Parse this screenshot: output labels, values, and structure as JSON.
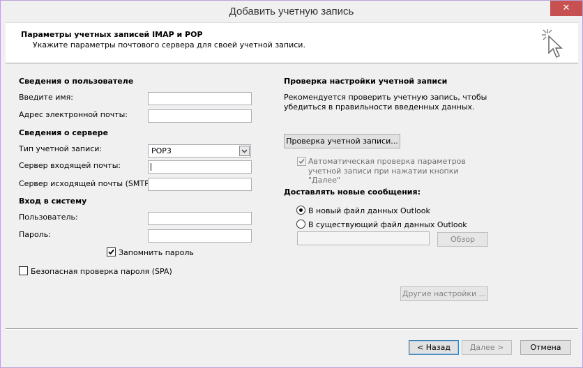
{
  "window": {
    "title": "Добавить учетную запись",
    "close_glyph": "✕"
  },
  "header": {
    "title": "Параметры учетных записей IMAP и POP",
    "subtitle": "Укажите параметры почтового сервера для своей учетной записи.",
    "icon": "wizard-cursor-icon"
  },
  "user_info": {
    "heading": "Сведения о пользователе",
    "name_label": "Введите имя:",
    "name_value": "",
    "email_label": "Адрес электронной почты:",
    "email_value": ""
  },
  "server_info": {
    "heading": "Сведения о сервере",
    "account_type_label": "Тип учетной записи:",
    "account_type_value": "POP3",
    "incoming_label": "Сервер входящей почты:",
    "incoming_value": "",
    "outgoing_label": "Сервер исходящей почты (SMTP):",
    "outgoing_value": ""
  },
  "login": {
    "heading": "Вход в систему",
    "user_label": "Пользователь:",
    "user_value": "",
    "password_label": "Пароль:",
    "password_value": "",
    "remember_label": "Запомнить пароль",
    "remember_checked": true,
    "spa_label": "Безопасная проверка пароля (SPA)",
    "spa_checked": false
  },
  "test": {
    "heading": "Проверка настройки учетной записи",
    "desc_line1": "Рекомендуется проверить учетную запись, чтобы",
    "desc_line2": "убедиться в правильности введенных данных.",
    "test_button": "Проверка учетной записи...",
    "auto_line1": "Автоматическая проверка параметров",
    "auto_line2": "учетной записи при нажатии кнопки",
    "auto_line3": "\"Далее\"",
    "auto_checked": true
  },
  "deliver": {
    "heading": "Доставлять новые сообщения:",
    "option_new": "В новый файл данных Outlook",
    "option_existing": "В существующий файл данных Outlook",
    "selected": "new",
    "path_value": "",
    "browse_button": "Обзор"
  },
  "more_settings_button": "Другие настройки ...",
  "footer": {
    "back": "< Назад",
    "next": "Далее >",
    "cancel": "Отмена"
  }
}
